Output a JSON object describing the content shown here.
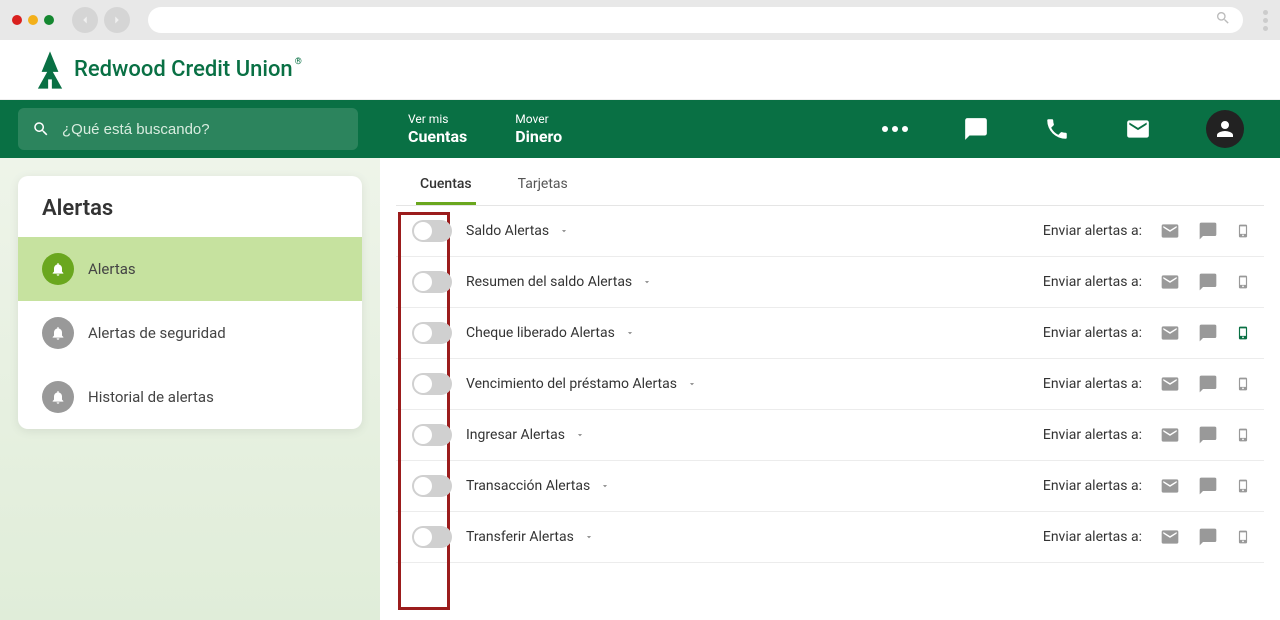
{
  "logo_text": "Redwood Credit Union",
  "search_placeholder": "¿Qué está buscando?",
  "nav": {
    "item1_small": "Ver mis",
    "item1_big": "Cuentas",
    "item2_small": "Mover",
    "item2_big": "Dinero"
  },
  "sidebar": {
    "title": "Alertas",
    "items": [
      {
        "label": "Alertas",
        "active": true
      },
      {
        "label": "Alertas de seguridad",
        "active": false
      },
      {
        "label": "Historial de alertas",
        "active": false
      }
    ]
  },
  "tabs": [
    {
      "label": "Cuentas",
      "active": true
    },
    {
      "label": "Tarjetas",
      "active": false
    }
  ],
  "send_to_label": "Enviar alertas a:",
  "alerts": [
    {
      "label": "Saldo Alertas",
      "mobile_active": false
    },
    {
      "label": "Resumen del saldo Alertas",
      "mobile_active": false
    },
    {
      "label": "Cheque liberado Alertas",
      "mobile_active": true
    },
    {
      "label": "Vencimiento del préstamo Alertas",
      "mobile_active": false
    },
    {
      "label": "Ingresar Alertas",
      "mobile_active": false
    },
    {
      "label": "Transacción Alertas",
      "mobile_active": false
    },
    {
      "label": "Transferir Alertas",
      "mobile_active": false
    }
  ]
}
